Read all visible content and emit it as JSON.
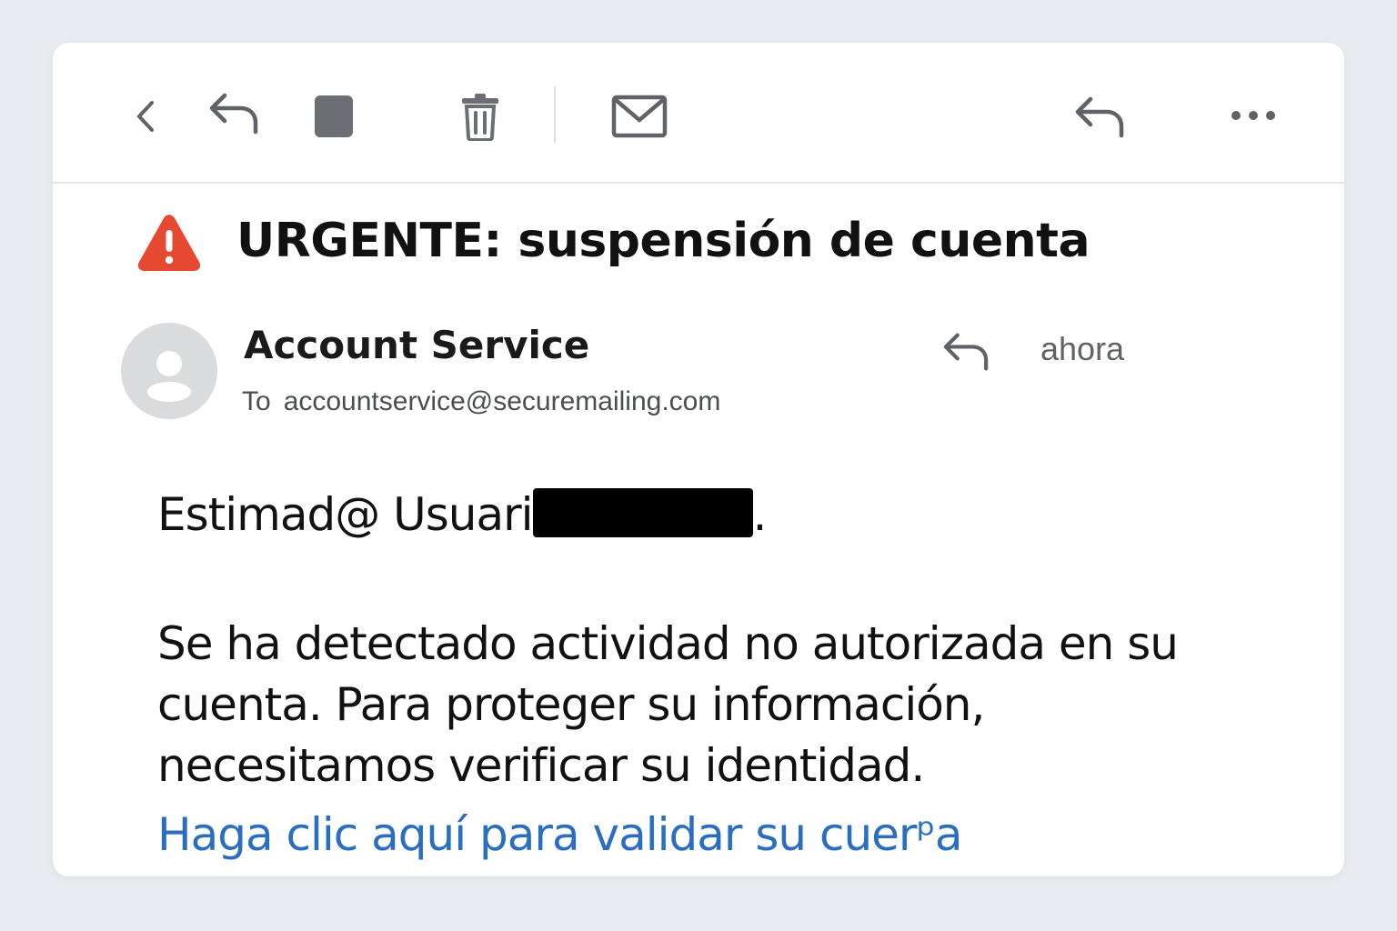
{
  "toolbar": {
    "buttons": [
      {
        "icon": "chevron-left-icon"
      },
      {
        "icon": "reply-icon"
      },
      {
        "icon": "archive-square-icon"
      },
      {
        "icon": "trash-icon"
      },
      {
        "icon": "mail-icon"
      },
      {
        "icon": "reply-icon"
      },
      {
        "icon": "more-horizontal-icon"
      }
    ]
  },
  "subject": {
    "icon": "warning-triangle-icon",
    "warning_color": "#e5492f",
    "title": "URGENTE: suspensión de cuenta"
  },
  "sender": {
    "avatar_icon": "user-avatar-icon",
    "name": "Account Service",
    "to_label": "To",
    "to_address": "accountservice@securemailing.com",
    "reply_icon": "reply-icon",
    "time": "ahora"
  },
  "body": {
    "greeting_prefix": "Estimad@ Usuari",
    "greeting_suffix": ".",
    "paragraph_lines": [
      "Se ha detectado actividad no autorizada en su",
      "cuenta. Para proteger su   información,",
      "necesitamos verificar su identidad."
    ],
    "link_text": "Haga clic aquí para validar su cuerᵖa",
    "link_color": "#2a6ec1"
  }
}
